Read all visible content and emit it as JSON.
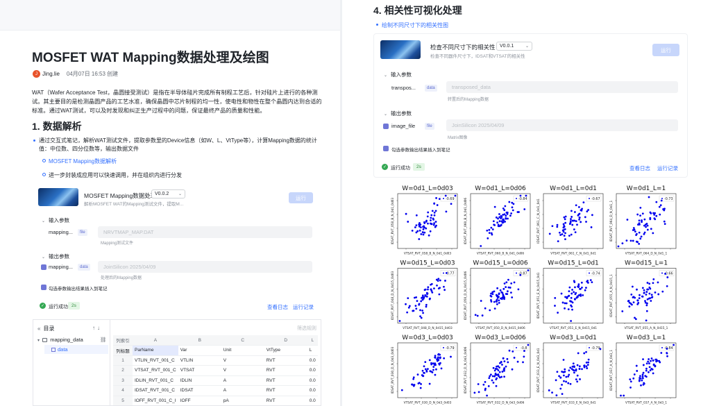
{
  "left_doc": {
    "title": "MOSFET WAT Mapping数据处理及绘图",
    "author": {
      "avatar_text": "J",
      "name": "Jing.lie",
      "meta": "04月07日 16:53 创建"
    },
    "intro": "WAT（Wafer Acceptance Test，晶圆接受测试）是指在半导体硅片完成所有制程工艺后，针对硅片上进行的各种测试。其主要目的是检测晶圆产品的工艺水准，确保晶圆中芯片制程的均一性，使电性和物性在整个晶圆内达到合适的标准。通过WAT测试，可以及时发现和纠正生产过程中的问题，保证最终产品的质量和性能。",
    "section1": {
      "heading": "1. 数据解析",
      "bullet": "通过交互式笔记，解析WAT测试文件，提取参数里的Device信息（如W、L、VtType等），计算Mapping数据的统计值：中位数、四分位数等，输出数据文件",
      "sub_items": [
        "MOSFET Mapping数据解析",
        "进一步封装成应用可以快速调用，并在组织内进行分发"
      ]
    },
    "node": {
      "title": "MOSFET Mapping数据处理",
      "version": "V0.0.2",
      "desc": "解析MOSFET WAT的Mapping测试文件，提取M...",
      "run_label": "运行",
      "input_label": "输入参数",
      "input_name": "mapping...",
      "input_tag": "file",
      "input_value": "NRVTMAP_MAP.DAT",
      "input_hint": "Mapping测试文件",
      "output_label": "输出参数",
      "output_name": "mapping...",
      "output_tag": "data",
      "output_value": "JoinSilicon 2025/04/09",
      "output_hint": "处理后的Mapping数据",
      "check_label": "勾选参数输出结果插入到笔记",
      "status": "运行成功",
      "duration": "2s",
      "log_link": "查看日志",
      "record_link": "运行记录"
    },
    "table_panel": {
      "toc_title": "目录",
      "toc_arrows": "↑↓",
      "tree": [
        "mapping_data",
        "data"
      ],
      "filter_label": "筛选规则",
      "col_letters": [
        "列索引",
        "A",
        "B",
        "C",
        "D",
        "L"
      ],
      "col_names": [
        "列标题",
        "ParName",
        "Var",
        "Unit",
        "VtType",
        "L"
      ],
      "rows": [
        [
          "1",
          "VTLIN_RVT_001_C",
          "VTLIN",
          "V",
          "RVT",
          "0.0"
        ],
        [
          "2",
          "VTSAT_RVT_001_C",
          "VTSAT",
          "V",
          "RVT",
          "0.0"
        ],
        [
          "3",
          "IDLIN_RVT_001_C",
          "IDLIN",
          "A",
          "RVT",
          "0.0"
        ],
        [
          "4",
          "IDSAT_RVT_001_C",
          "IDSAT",
          "A",
          "RVT",
          "0.0"
        ],
        [
          "5",
          "IOFF_RVT_001_C_I",
          "IOFF",
          "pA",
          "RVT",
          "0.0"
        ]
      ]
    }
  },
  "right_doc": {
    "heading": "4. 相关性可视化处理",
    "bullet": "绘制不同尺寸下的相关性图",
    "node": {
      "title": "检查不同尺寸下的相关性",
      "version": "V0.0.1",
      "desc": "检查不同器件尺寸下，IDSAT和VTSAT的相关性",
      "run_label": "运行",
      "input_label": "输入参数",
      "input_name": "transpos...",
      "input_tag": "data",
      "input_value": "transposed_data",
      "input_hint": "转置后的Mapping数据",
      "output_label": "输出参数",
      "output_name": "image_file",
      "output_tag": "file",
      "output_value": "JoinSilicon 2025/04/09",
      "output_hint": "Matrix图像",
      "check_label": "勾选参数输出结果插入到笔记",
      "status": "运行成功",
      "duration": "2s",
      "log_link": "查看日志",
      "record_link": "运行记录"
    }
  },
  "chart_data": {
    "type": "scatter",
    "layout": "3x4 grid",
    "marker_color": "#0000ee",
    "legend_placement": "top-right",
    "grid": false,
    "panels": [
      {
        "title": "W=0d1_L=0d03",
        "xlabel": "VTSAT_RVT_058_B_N_0d1_0d03",
        "ylabel": "IDSAT_RVT_058_B_N_0d1_0d03",
        "legend": "-0.69",
        "r": -0.69
      },
      {
        "title": "W=0d1_L=0d06",
        "xlabel": "VTSAT_RVT_060_B_N_0d1_0d06",
        "ylabel": "IDSAT_RVT_060_B_N_0d1_0d06",
        "legend": "-0.84",
        "r": -0.84
      },
      {
        "title": "W=0d1_L=0d1",
        "xlabel": "VTSAT_RVT_061_C_N_0d1_0d1",
        "ylabel": "IDSAT_RVT_061_C_N_0d1_0d1",
        "legend": "-0.67",
        "r": -0.67
      },
      {
        "title": "W=0d1_L=1",
        "xlabel": "VTSAT_RVT_064_D_N_0d1_1",
        "ylabel": "IDSAT_RVT_064_D_N_0d1_1",
        "legend": "-0.73",
        "r": -0.73
      },
      {
        "title": "W=0d15_L=0d03",
        "xlabel": "VTSAT_RVT_048_D_N_0d15_0d03",
        "ylabel": "IDSAT_RVT_048_D_N_0d15_0d03",
        "legend": "-0.77",
        "r": -0.77
      },
      {
        "title": "W=0d15_L=0d06",
        "xlabel": "VTSAT_RVT_050_D_N_0d15_0d06",
        "ylabel": "IDSAT_RVT_050_D_N_0d15_0d06",
        "legend": "-0.87",
        "r": -0.87
      },
      {
        "title": "W=0d15_L=0d1",
        "xlabel": "VTSAT_RVT_051_E_N_0d15_0d1",
        "ylabel": "IDSAT_RVT_051_E_N_0d15_0d1",
        "legend": "-0.74",
        "r": -0.74
      },
      {
        "title": "W=0d15_L=1",
        "xlabel": "VTSAT_RVT_055_A_N_0d15_1",
        "ylabel": "IDSAT_RVT_055_A_N_0d15_1",
        "legend": "-0.66",
        "r": -0.66
      },
      {
        "title": "W=0d3_L=0d03",
        "xlabel": "VTSAT_RVT_030_D_N_0d3_0d03",
        "ylabel": "IDSAT_RVT_030_D_N_0d3_0d03",
        "legend": "-0.79",
        "r": -0.79
      },
      {
        "title": "W=0d3_L=0d06",
        "xlabel": "VTSAT_RVT_032_D_N_0d3_0d06",
        "ylabel": "IDSAT_RVT_032_D_N_0d3_0d06",
        "legend": "-0.8",
        "r": -0.8
      },
      {
        "title": "W=0d3_L=0d1",
        "xlabel": "VTSAT_RVT_033_E_N_0d3_0d1",
        "ylabel": "IDSAT_RVT_033_E_N_0d3_0d1",
        "legend": "-0.79",
        "r": -0.79
      },
      {
        "title": "W=0d3_L=1",
        "xlabel": "VTSAT_RVT_037_A_N_0d3_1",
        "ylabel": "IDSAT_RVT_037_A_N_0d3_1",
        "legend": "-0.84",
        "r": -0.84
      }
    ]
  }
}
